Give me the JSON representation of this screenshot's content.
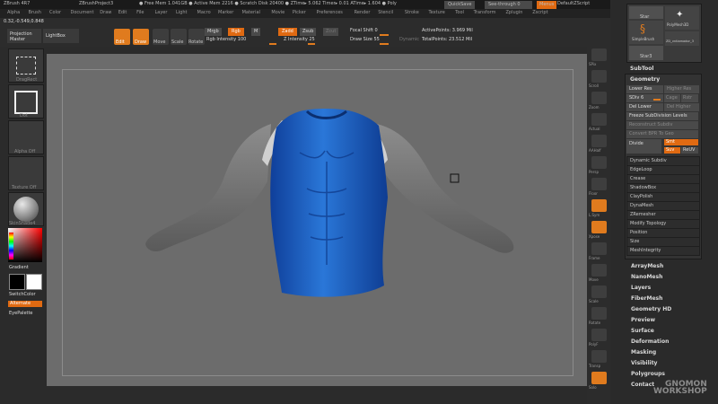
{
  "titlebar": {
    "app": "ZBrush 4R7",
    "project": "ZBrushProject3",
    "stats": "● Free Mem 1.041GB ● Active Mem 2216 ● Scratch Disk 20400 ● ZTime▸ 5.062 Timer▸ 0.01 ATime▸ 1.604 ● Poly",
    "quicksave": "QuickSave",
    "seethrough": "See-through  0",
    "menus": "Menus",
    "script": "DefaultZScript"
  },
  "menubar": [
    "Alpha",
    "Brush",
    "Color",
    "Document",
    "Draw",
    "Edit",
    "File",
    "Layer",
    "Light",
    "Macro",
    "Marker",
    "Material",
    "Movie",
    "Picker",
    "Preferences",
    "Render",
    "Stencil",
    "Stroke",
    "Texture",
    "Tool",
    "Transform",
    "Zplugin",
    "Zscript"
  ],
  "coords": "0.32,-0.549,0.848",
  "shelf": {
    "projection_master": "Projection\nMaster",
    "lightbox": "LightBox",
    "edit": "Edit",
    "draw": "Draw",
    "move": "Move",
    "scale": "Scale",
    "rotate": "Rotate",
    "mrgb": "Mrgb",
    "rgb": "Rgb",
    "m": "M",
    "rgb_intensity": "Rgb Intensity 100",
    "zadd": "Zadd",
    "zsub": "Zsub",
    "zcut": "Zcut",
    "z_intensity": "Z Intensity 25",
    "focal_shift": "Focal Shift 0",
    "draw_size": "Draw Size 55",
    "dynamic": "Dynamic",
    "active_points": "ActivePoints: 3.969 Mil",
    "total_points": "TotalPoints: 23.512 Mil"
  },
  "leftshelf": {
    "stroke": "DragRect",
    "alpha": "Alpha Off",
    "texture": "Texture Off",
    "material": "SkinShade4",
    "gradient": "Gradient",
    "switchcolor": "SwitchColor",
    "alternate": "Alternate",
    "eyepalette": "EyePalette",
    "tool_top": "Dot"
  },
  "rightshelf": [
    "SPix",
    "Scroll",
    "Zoom",
    "Actual",
    "AAHalf",
    "Persp",
    "Floor",
    "L.Sym",
    "Xpose",
    "Frame",
    "Move",
    "Scale",
    "Rotate",
    "PolyF",
    "Transp",
    "Solo"
  ],
  "tray": {
    "tools": [
      "Star",
      "PolyMesh3D",
      "SimpleBrush",
      "ZD_vntiamador_3",
      "Star3"
    ],
    "subtool": "SubTool",
    "geometry": "Geometry",
    "lower_res": "Lower Res",
    "higher_res": "Higher Res",
    "sdiv": "SDiv 6",
    "cage": "Cage",
    "rstr": "Rstr",
    "del_lower": "Del Lower",
    "del_higher": "Del Higher",
    "freeze": "Freeze SubDivision Levels",
    "reconstruct": "Reconstruct Subdiv",
    "convert_bpr": "Convert BPR To Geo",
    "divide": "Divide",
    "smt": "Smt",
    "suv": "Suv",
    "reuv": "ReUV",
    "subitems": [
      "Dynamic Subdiv",
      "EdgeLoop",
      "Crease",
      "ShadowBox",
      "ClayPolish",
      "DynaMesh",
      "ZRemesher",
      "Modify Topology",
      "Position",
      "Size",
      "MeshIntegrity"
    ],
    "menuitems": [
      "ArrayMesh",
      "NanoMesh",
      "Layers",
      "FiberMesh",
      "Geometry HD",
      "Preview",
      "Surface",
      "Deformation",
      "Masking",
      "Visibility",
      "Polygroups",
      "Contact"
    ]
  },
  "watermark": "GNOMON\nWORKSHOP",
  "colors": {
    "accent": "#e07b1e",
    "shirt": "#1f63c4",
    "sleeve": "#7c7c7c"
  }
}
